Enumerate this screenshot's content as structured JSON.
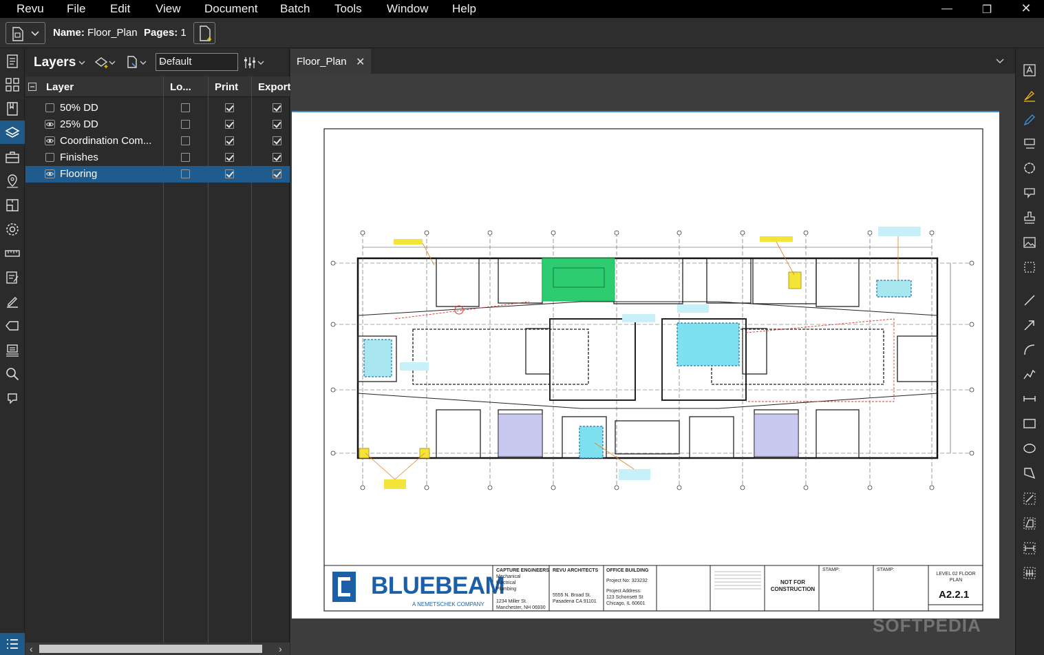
{
  "menu": [
    "Revu",
    "File",
    "Edit",
    "View",
    "Document",
    "Batch",
    "Tools",
    "Window",
    "Help"
  ],
  "toolbar": {
    "name_label": "Name:",
    "name_value": "Floor_Plan",
    "pages_label": "Pages:",
    "pages_value": "1"
  },
  "layers_panel": {
    "title": "Layers",
    "profile_select": "Default",
    "columns": [
      "Layer",
      "Lo...",
      "Print",
      "Export"
    ],
    "rows": [
      {
        "name": "50% DD",
        "visible": false,
        "locked": false,
        "print": true,
        "export": true,
        "selected": false
      },
      {
        "name": "25% DD",
        "visible": true,
        "locked": false,
        "print": true,
        "export": true,
        "selected": false
      },
      {
        "name": "Coordination Com...",
        "visible": true,
        "locked": false,
        "print": true,
        "export": true,
        "selected": false
      },
      {
        "name": "Finishes",
        "visible": false,
        "locked": false,
        "print": true,
        "export": true,
        "selected": false
      },
      {
        "name": "Flooring",
        "visible": true,
        "locked": false,
        "print": true,
        "export": true,
        "selected": true
      }
    ]
  },
  "document": {
    "tab_title": "Floor_Plan"
  },
  "title_block": {
    "logo": "BLUEBEAM",
    "logo_sub": "A NEMETSCHEK COMPANY",
    "engineers_title": "CAPTURE ENGINEERS",
    "engineers_lines": [
      "Mechanical",
      "Electrical",
      "Plumbing"
    ],
    "engineers_address": [
      "1234 Miller St.",
      "Manchester, NH 06930"
    ],
    "architects_title": "REVU ARCHITECTS",
    "architects_address": [
      "5555 N. Broad St.",
      "Pasadena CA 91101"
    ],
    "project_title": "OFFICE BUILDING",
    "project_no": "Project No: 323232",
    "project_address_label": "Project Address:",
    "project_address": [
      "123 Schonsett St",
      "Chicago, IL 60601"
    ],
    "nfc": [
      "NOT FOR",
      "CONSTRUCTION"
    ],
    "stamp1": "STAMP:",
    "stamp2": "STAMP:",
    "sheet_desc": [
      "LEVEL 02 FLOOR",
      "PLAN"
    ],
    "sheet_no": "A2.2.1"
  },
  "watermark": "SOFTPEDIA",
  "colors": {
    "selection": "#1f5b8d",
    "accent_blue": "#3b8bd0",
    "plan_green": "#2ecc71",
    "plan_cyan": "#7fe0f0",
    "plan_lavender": "#c8c8f0",
    "plan_yellow": "#f3e43a",
    "markup_red": "#e03030",
    "logo_blue": "#1a5fa8"
  }
}
